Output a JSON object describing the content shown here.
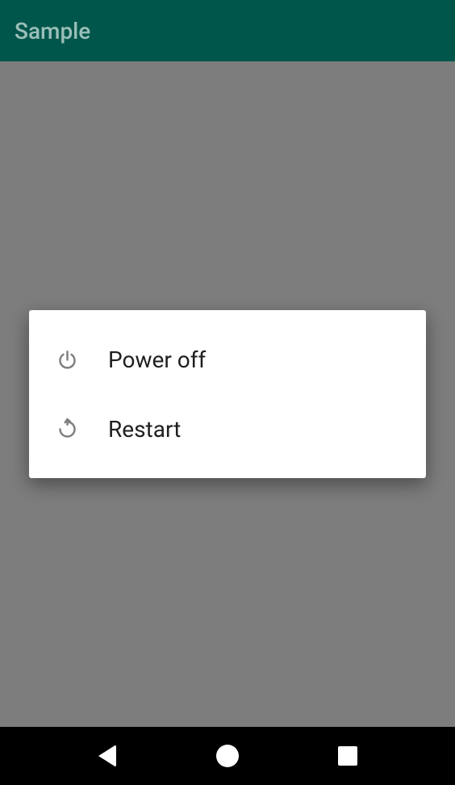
{
  "appbar": {
    "title": "Sample"
  },
  "dialog": {
    "items": [
      {
        "label": "Power off",
        "icon": "power"
      },
      {
        "label": "Restart",
        "icon": "restart"
      }
    ]
  }
}
